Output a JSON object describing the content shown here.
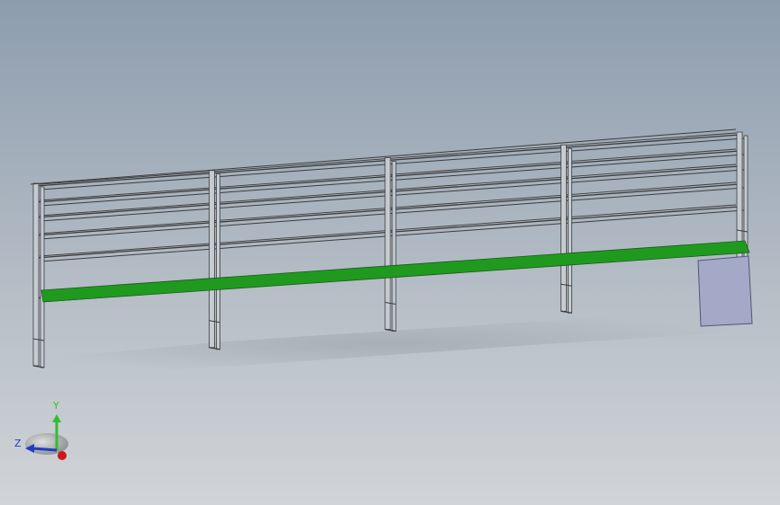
{
  "viewport": {
    "background_top": "#8d9dae",
    "background_bottom": "#d1d4d8"
  },
  "model": {
    "frame_color": "#3c3c3c",
    "frame_fill": "#c6cbd2",
    "work_surface_color": "#1f9a1f",
    "side_panel_color": "#a4a9c8",
    "bays": 4,
    "shelf_levels": 5
  },
  "triad": {
    "x_color": "#d01818",
    "y_color": "#2fbf2f",
    "z_color": "#1f3fbf",
    "y_label": "Y",
    "z_label": "Z"
  }
}
